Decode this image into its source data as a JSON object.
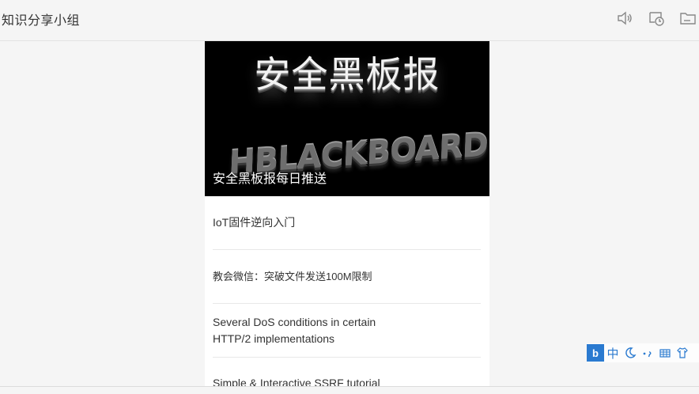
{
  "window": {
    "title": "知识分享小组"
  },
  "toolbar": {
    "icons": [
      "speaker-icon",
      "timer-icon",
      "folder-icon"
    ]
  },
  "hero": {
    "heading": "安全黑板报",
    "art_text": "HBLACKBOARD",
    "caption": "安全黑板报每日推送"
  },
  "articles": [
    {
      "title": "IoT固件逆向入门"
    },
    {
      "title": "教会微信：突破文件发送100M限制"
    },
    {
      "title": "Several DoS conditions in certain HTTP/2 implementations"
    },
    {
      "title": "Simple & Interactive SSRF tutorial"
    }
  ],
  "ime": {
    "logo": "b",
    "mode": "中",
    "items": [
      "moon-icon",
      "punct-icon",
      "keyboard-icon",
      "shirt-icon"
    ]
  }
}
